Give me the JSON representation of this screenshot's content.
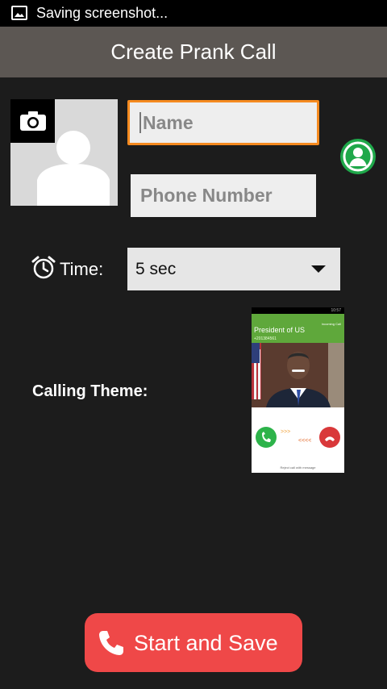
{
  "status_bar": {
    "text": "Saving screenshot..."
  },
  "app_bar": {
    "title": "Create Prank Call"
  },
  "form": {
    "name_placeholder": "Name",
    "phone_placeholder": "Phone Number",
    "time_label": "Time:",
    "time_value": "5 sec",
    "theme_label": "Calling Theme:"
  },
  "theme_preview": {
    "caller_name": "President of US",
    "caller_number": "+201384561",
    "incoming_label": "Incoming Call",
    "clock": "10:57",
    "swipe_right": ">>>",
    "swipe_left": "<<<<",
    "footer": "Reject call with message"
  },
  "actions": {
    "start_label": "Start and Save"
  },
  "colors": {
    "app_bar": "#5c5753",
    "accent_focus": "#f58a1f",
    "contact_icon": "#1fa84a",
    "start_button": "#ef4848",
    "background": "#1c1c1c"
  },
  "icons": {
    "screenshot": "screenshot-icon",
    "camera": "camera-icon",
    "contact": "contact-icon",
    "alarm": "alarm-clock-icon",
    "dropdown": "chevron-down-icon",
    "phone": "phone-icon"
  }
}
